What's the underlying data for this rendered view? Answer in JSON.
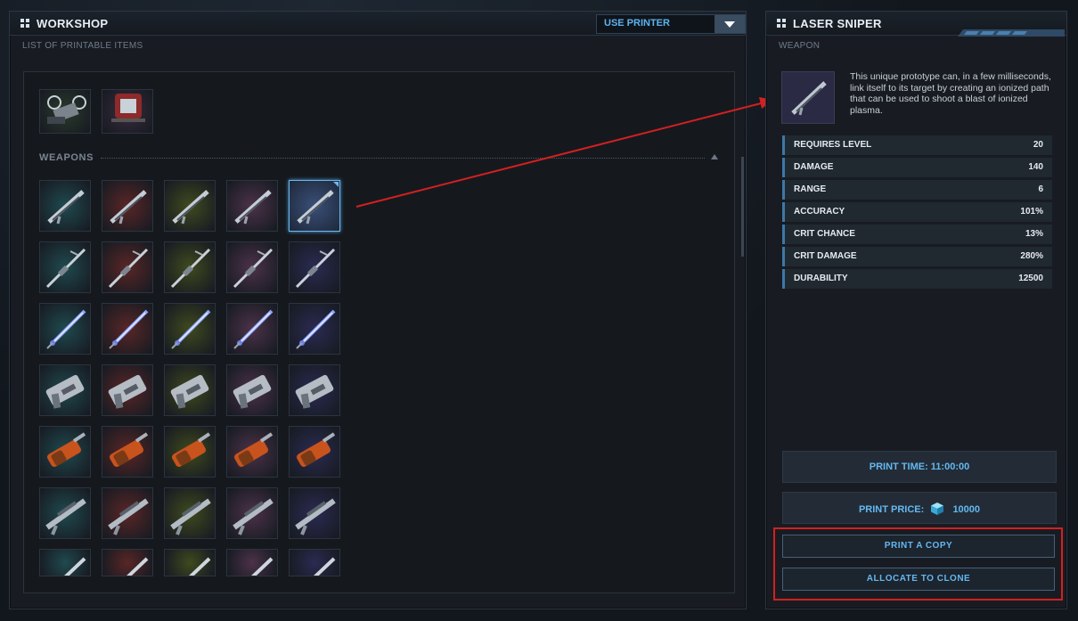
{
  "workshop": {
    "title": "WORKSHOP",
    "subtitle": "LIST OF PRINTABLE ITEMS",
    "printer_select_label": "USE PRINTER",
    "category": "WEAPONS",
    "top_items": [
      "drone-icon",
      "turret-icon"
    ],
    "weapon_tints": [
      "#1f4a4f",
      "#5a2626",
      "#3f4a1e",
      "#4c3249",
      "#2b2a52"
    ],
    "weapon_rows": [
      "laser-sniper",
      "spear-rifle",
      "energy-sword",
      "heavy-blaster",
      "flamethrower",
      "scoped-rifle",
      "blade"
    ],
    "selected_cell": {
      "row": 0,
      "col": 4
    }
  },
  "detail": {
    "title": "LASER SNIPER",
    "subtitle": "WEAPON",
    "description": "This unique prototype can, in a few milliseconds, link itself to its target by creating an ionized path that can be used to shoot a blast of ionized plasma.",
    "stats": [
      {
        "name": "REQUIRES LEVEL",
        "value": "20"
      },
      {
        "name": "DAMAGE",
        "value": "140"
      },
      {
        "name": "RANGE",
        "value": "6"
      },
      {
        "name": "ACCURACY",
        "value": "101%"
      },
      {
        "name": "CRIT CHANCE",
        "value": "13%"
      },
      {
        "name": "CRIT DAMAGE",
        "value": "280%"
      },
      {
        "name": "DURABILITY",
        "value": "12500"
      }
    ],
    "print_time": "PRINT TIME: 11:00:00",
    "print_price_label": "PRINT PRICE:",
    "print_price_value": "10000",
    "print_copy_label": "PRINT A COPY",
    "allocate_label": "ALLOCATE TO CLONE"
  },
  "colors": {
    "accent": "#63b8f2",
    "annotation": "#d32020"
  }
}
